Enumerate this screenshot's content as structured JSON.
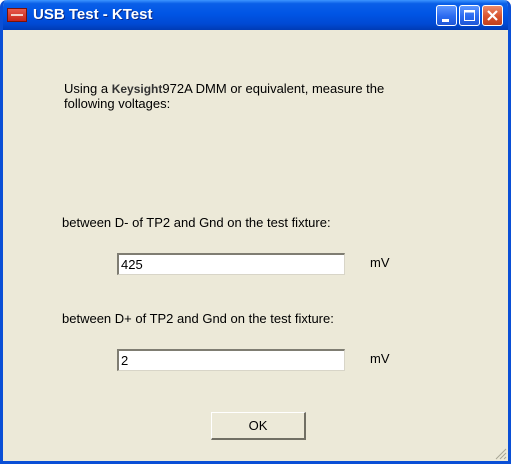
{
  "window": {
    "title": "USB Test - KTest",
    "controls": [
      "minimize",
      "maximize",
      "close"
    ]
  },
  "instructions": {
    "prefix": "Using a ",
    "brand": "Keysight",
    "model": "972A",
    "line1_rest": " DMM or equivalent, measure the",
    "line2": "following voltages:"
  },
  "measurements": [
    {
      "label": "between D- of TP2 and Gnd on the test fixture:",
      "value": "425",
      "unit": "mV"
    },
    {
      "label": "between D+ of TP2 and Gnd on the test fixture:",
      "value": "2",
      "unit": "mV"
    }
  ],
  "buttons": {
    "ok": "OK"
  },
  "colors": {
    "titlebar": "#0055e5",
    "window_bg": "#ece9d8",
    "close_button": "#d7532e"
  }
}
